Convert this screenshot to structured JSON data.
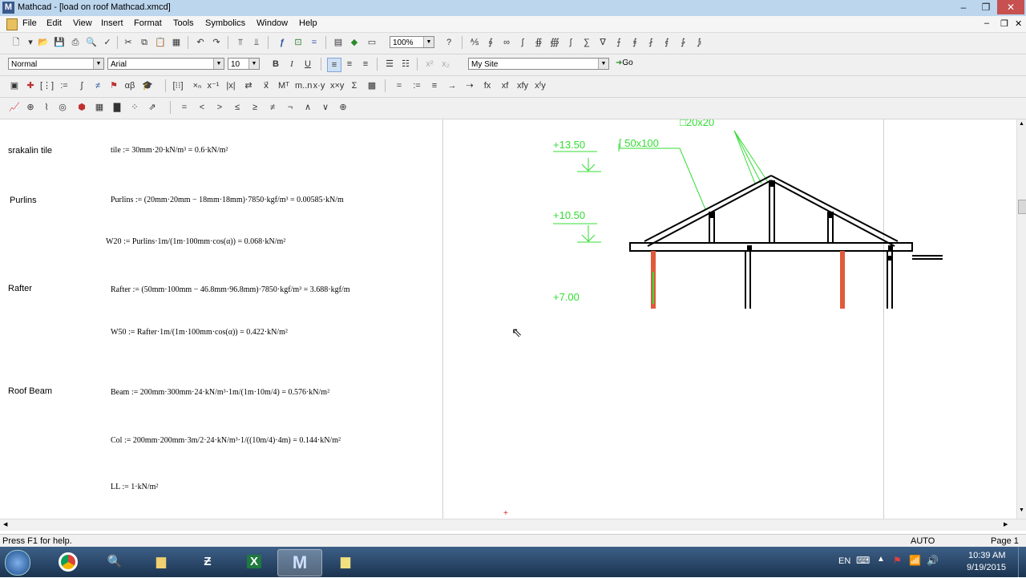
{
  "window": {
    "title": "Mathcad - [load on roof Mathcad.xmcd]",
    "app_icon": "M",
    "controls": [
      "–",
      "❐",
      "✕"
    ]
  },
  "menu": [
    "File",
    "Edit",
    "View",
    "Insert",
    "Format",
    "Tools",
    "Symbolics",
    "Window",
    "Help"
  ],
  "toolbar": {
    "zoom": "100%",
    "style": "Normal",
    "font": "Arial",
    "size": "10",
    "bold": "B",
    "italic": "I",
    "underline": "U",
    "resources": "My Site",
    "go": "Go"
  },
  "worksheet": {
    "rows": [
      {
        "label": "srakalin tile",
        "eq": "tile := 30mm·20·kN/m³ = 0.6·kN/m²"
      },
      {
        "label": "Purlins",
        "eq": "Purlins := (20mm·20mm − 18mm·18mm)·7850·kgf/m³ = 0.00585·kN/m"
      },
      {
        "label": "",
        "eq": "W20 := Purlins·1m/(1m·100mm·cos(α)) = 0.068·kN/m²"
      },
      {
        "label": "Rafter",
        "eq": "Rafter := (50mm·100mm − 46.8mm·96.8mm)·7850·kgf/m³ = 3.688·kgf/m"
      },
      {
        "label": "",
        "eq": "W50 := Rafter·1m/(1m·100mm·cos(α)) = 0.422·kN/m²"
      },
      {
        "label": "Roof Beam",
        "eq": "Beam := 200mm·300mm·24·kN/m³·1m/(1m·10m/4) = 0.576·kN/m²"
      },
      {
        "label": "",
        "eq": "Col := 200mm·200mm·3m/2·24·kN/m³·1/((10m/4)·4m) = 0.144·kN/m²"
      },
      {
        "label": "",
        "eq": "LL := 1·kN/m²"
      }
    ]
  },
  "drawing": {
    "levels": [
      "+13.50",
      "+10.50",
      "+7.00"
    ],
    "labels": [
      "[ 50x100",
      "□20x20"
    ],
    "colors": {
      "annotation": "#33dd33",
      "column": "#e05a3a",
      "structure": "#000000"
    }
  },
  "status": {
    "help": "Press F1 for help.",
    "mode": "AUTO",
    "page": "Page 1"
  },
  "taskbar": {
    "lang": "EN",
    "time": "10:39 AM",
    "date": "9/19/2015",
    "apps": [
      "chrome",
      "search",
      "explorer",
      "archive",
      "excel",
      "mathcad",
      "notes"
    ]
  }
}
